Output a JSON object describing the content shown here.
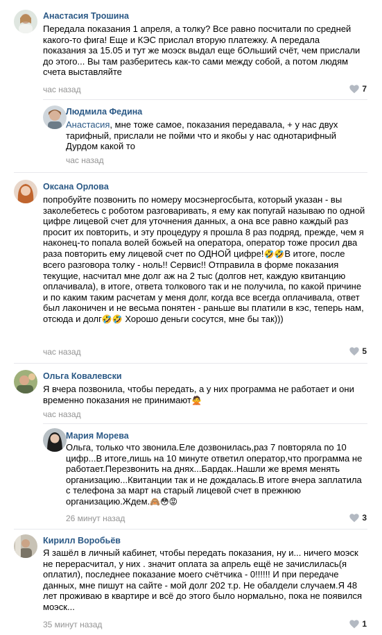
{
  "comments": [
    {
      "author": "Анастасия Трошина",
      "text": "Передала показания 1 апреля, а толку? Все равно посчитали по средней какого-то фига! Еще и КЭС прислал вторую платежку. А передала показания за 15.05 и тут же моэск выдал еще бОльший счёт, чем прислали до этого... Вы там разберитесь как-то сами между собой, а потом людям счета выставляйте",
      "time": "час назад",
      "likes": "7"
    },
    {
      "author": "Людмила Федина",
      "mention": "Анастасия",
      "text": ", мне тоже самое, показания передавала, + у нас двух тарифный, прислали не пойми что и якобы у нас однотарифный Дурдом какой то",
      "time": "час назад"
    },
    {
      "author": "Оксана Орлова",
      "text": "попробуйте позвонить по номеру мосэнергосбыта, который указан - вы заколебетесь с роботом разговаривать, я ему как попугай называю по одной цифре лицевой счет для уточнения данных, а она все равно каждый раз просит их повторить, и эту процедуру я прошла 8 раз подряд, прежде, чем я наконец-то попала волей божьей на оператора, оператор тоже просил два раза повторить ему лицевой счет по ОДНОЙ цифре!",
      "text_b": "В итоге, после всего разговора толку - ноль!! Сервис!! Отправила в форме показания текущие, насчитал мне долг аж на 2 тыс (долгов нет, каждую квитанцию оплачивала), в итоге, ответа толкового так и не получила, по какой причине и по каким таким расчетам у меня долг, когда все всегда оплачивала, ответ был лаконичен и не весьма понятен - раньше вы платили в кэс, теперь нам, отсюда и долг",
      "text_c": " Хорошо деньги сосутся, мне бы так)))",
      "emoji_a": "🤣🤣",
      "emoji_b": "🤣🤣",
      "time": "час назад",
      "likes": "5"
    },
    {
      "author": "Ольга Ковалевски",
      "text": "Я вчера позвонила, чтобы передать, а у них программа не работает и они временно показания не принимают",
      "emoji": "🙅",
      "time": "час назад"
    },
    {
      "author": "Мария Морева",
      "text": "Ольга, только что звонила.Еле дозвонилась,раз 7 повторяла по 10 цифр...В итоге,лишь на 10 минуте ответил оператор,что программа не работает.Перезвонить на днях...Бардак..Нашли же время менять организацию...Квитанции так и не дождалась.В итоге вчера заплатила с телефона за март на старый лицевой счет в прежнюю организацию.Ждем.",
      "emoji": "🙈😳😡",
      "time": "26 минут назад",
      "likes": "3"
    },
    {
      "author": "Кирилл Воробьёв",
      "text": "Я зашёл в личный кабинет, чтобы передать показания, ну и... ничего моэск не перерасчитал, у них . значит оплата за апрель ещё не зачислилась(я оплатил), последнее показание моего счётчика - 0!!!!!! И при передаче данных, мне пишут на сайте - мой долг 202 т.р. Не обалдели случаем.Я 48 лет проживаю в квартире и всё до этого было нормально, пока не появился моэск...",
      "time": "35 минут назад",
      "likes": "1"
    }
  ],
  "colors": {
    "author": "#2a5885",
    "time": "#939393",
    "divider": "#e7e8ec",
    "heart": "#b3b9c2"
  },
  "icons": {
    "like": "heart-icon"
  }
}
